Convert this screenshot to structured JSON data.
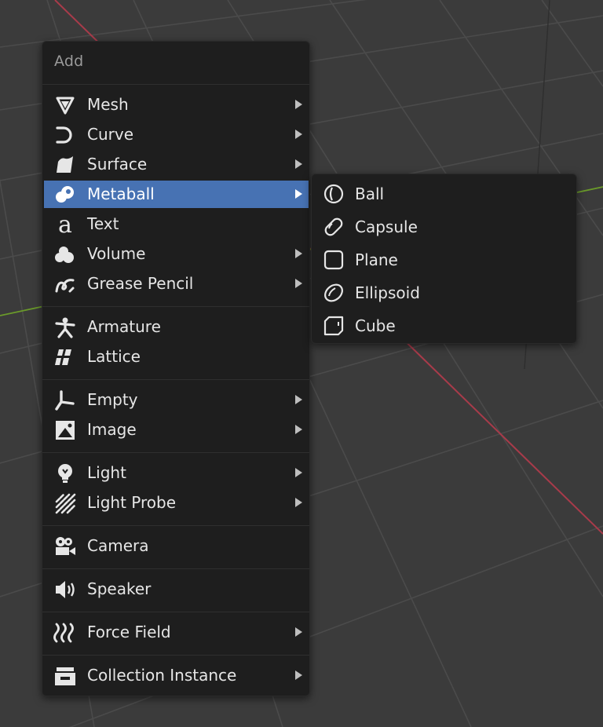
{
  "viewport": {
    "background": "#3b3b3b",
    "grid_color": "#4a4a4a",
    "x_axis_color": "#a83b4a",
    "y_axis_color": "#6a9a2a"
  },
  "add_menu": {
    "title": "Add",
    "accent": "#4772b3",
    "items": [
      {
        "label": "Mesh",
        "icon": "mesh-icon",
        "submenu": true
      },
      {
        "label": "Curve",
        "icon": "curve-icon",
        "submenu": true
      },
      {
        "label": "Surface",
        "icon": "surface-icon",
        "submenu": true
      },
      {
        "label": "Metaball",
        "icon": "metaball-icon",
        "submenu": true,
        "active": true
      },
      {
        "label": "Text",
        "icon": "text-icon",
        "submenu": false
      },
      {
        "label": "Volume",
        "icon": "volume-icon",
        "submenu": true
      },
      {
        "label": "Grease Pencil",
        "icon": "grease-pencil-icon",
        "submenu": true
      },
      {
        "label": "Armature",
        "icon": "armature-icon",
        "submenu": false
      },
      {
        "label": "Lattice",
        "icon": "lattice-icon",
        "submenu": false
      },
      {
        "label": "Empty",
        "icon": "empty-icon",
        "submenu": true
      },
      {
        "label": "Image",
        "icon": "image-icon",
        "submenu": true
      },
      {
        "label": "Light",
        "icon": "light-icon",
        "submenu": true
      },
      {
        "label": "Light Probe",
        "icon": "light-probe-icon",
        "submenu": true
      },
      {
        "label": "Camera",
        "icon": "camera-icon",
        "submenu": false
      },
      {
        "label": "Speaker",
        "icon": "speaker-icon",
        "submenu": false
      },
      {
        "label": "Force Field",
        "icon": "force-field-icon",
        "submenu": true
      },
      {
        "label": "Collection Instance",
        "icon": "collection-instance-icon",
        "submenu": true
      }
    ]
  },
  "metaball_submenu": {
    "items": [
      {
        "label": "Ball",
        "icon": "meta-ball-icon"
      },
      {
        "label": "Capsule",
        "icon": "meta-capsule-icon"
      },
      {
        "label": "Plane",
        "icon": "meta-plane-icon"
      },
      {
        "label": "Ellipsoid",
        "icon": "meta-ellipsoid-icon"
      },
      {
        "label": "Cube",
        "icon": "meta-cube-icon"
      }
    ]
  }
}
